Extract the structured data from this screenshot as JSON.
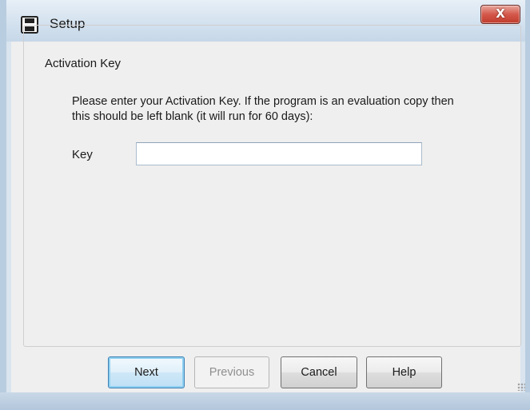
{
  "window": {
    "title": "Setup",
    "close_glyph": "X"
  },
  "icons": {
    "app": "floppy-disk-icon",
    "close": "close-icon",
    "grip": "resize-grip-icon"
  },
  "group": {
    "legend": "Activation Key",
    "instructions": "Please enter your Activation Key. If the program is an evaluation copy then this should be left blank (it will run for 60 days):"
  },
  "key_field": {
    "label": "Key",
    "value": "",
    "placeholder": ""
  },
  "buttons": {
    "next": "Next",
    "previous": "Previous",
    "cancel": "Cancel",
    "help": "Help"
  },
  "colors": {
    "default_button_border": "#3c7fb1",
    "close_button": "#c03c2c"
  }
}
